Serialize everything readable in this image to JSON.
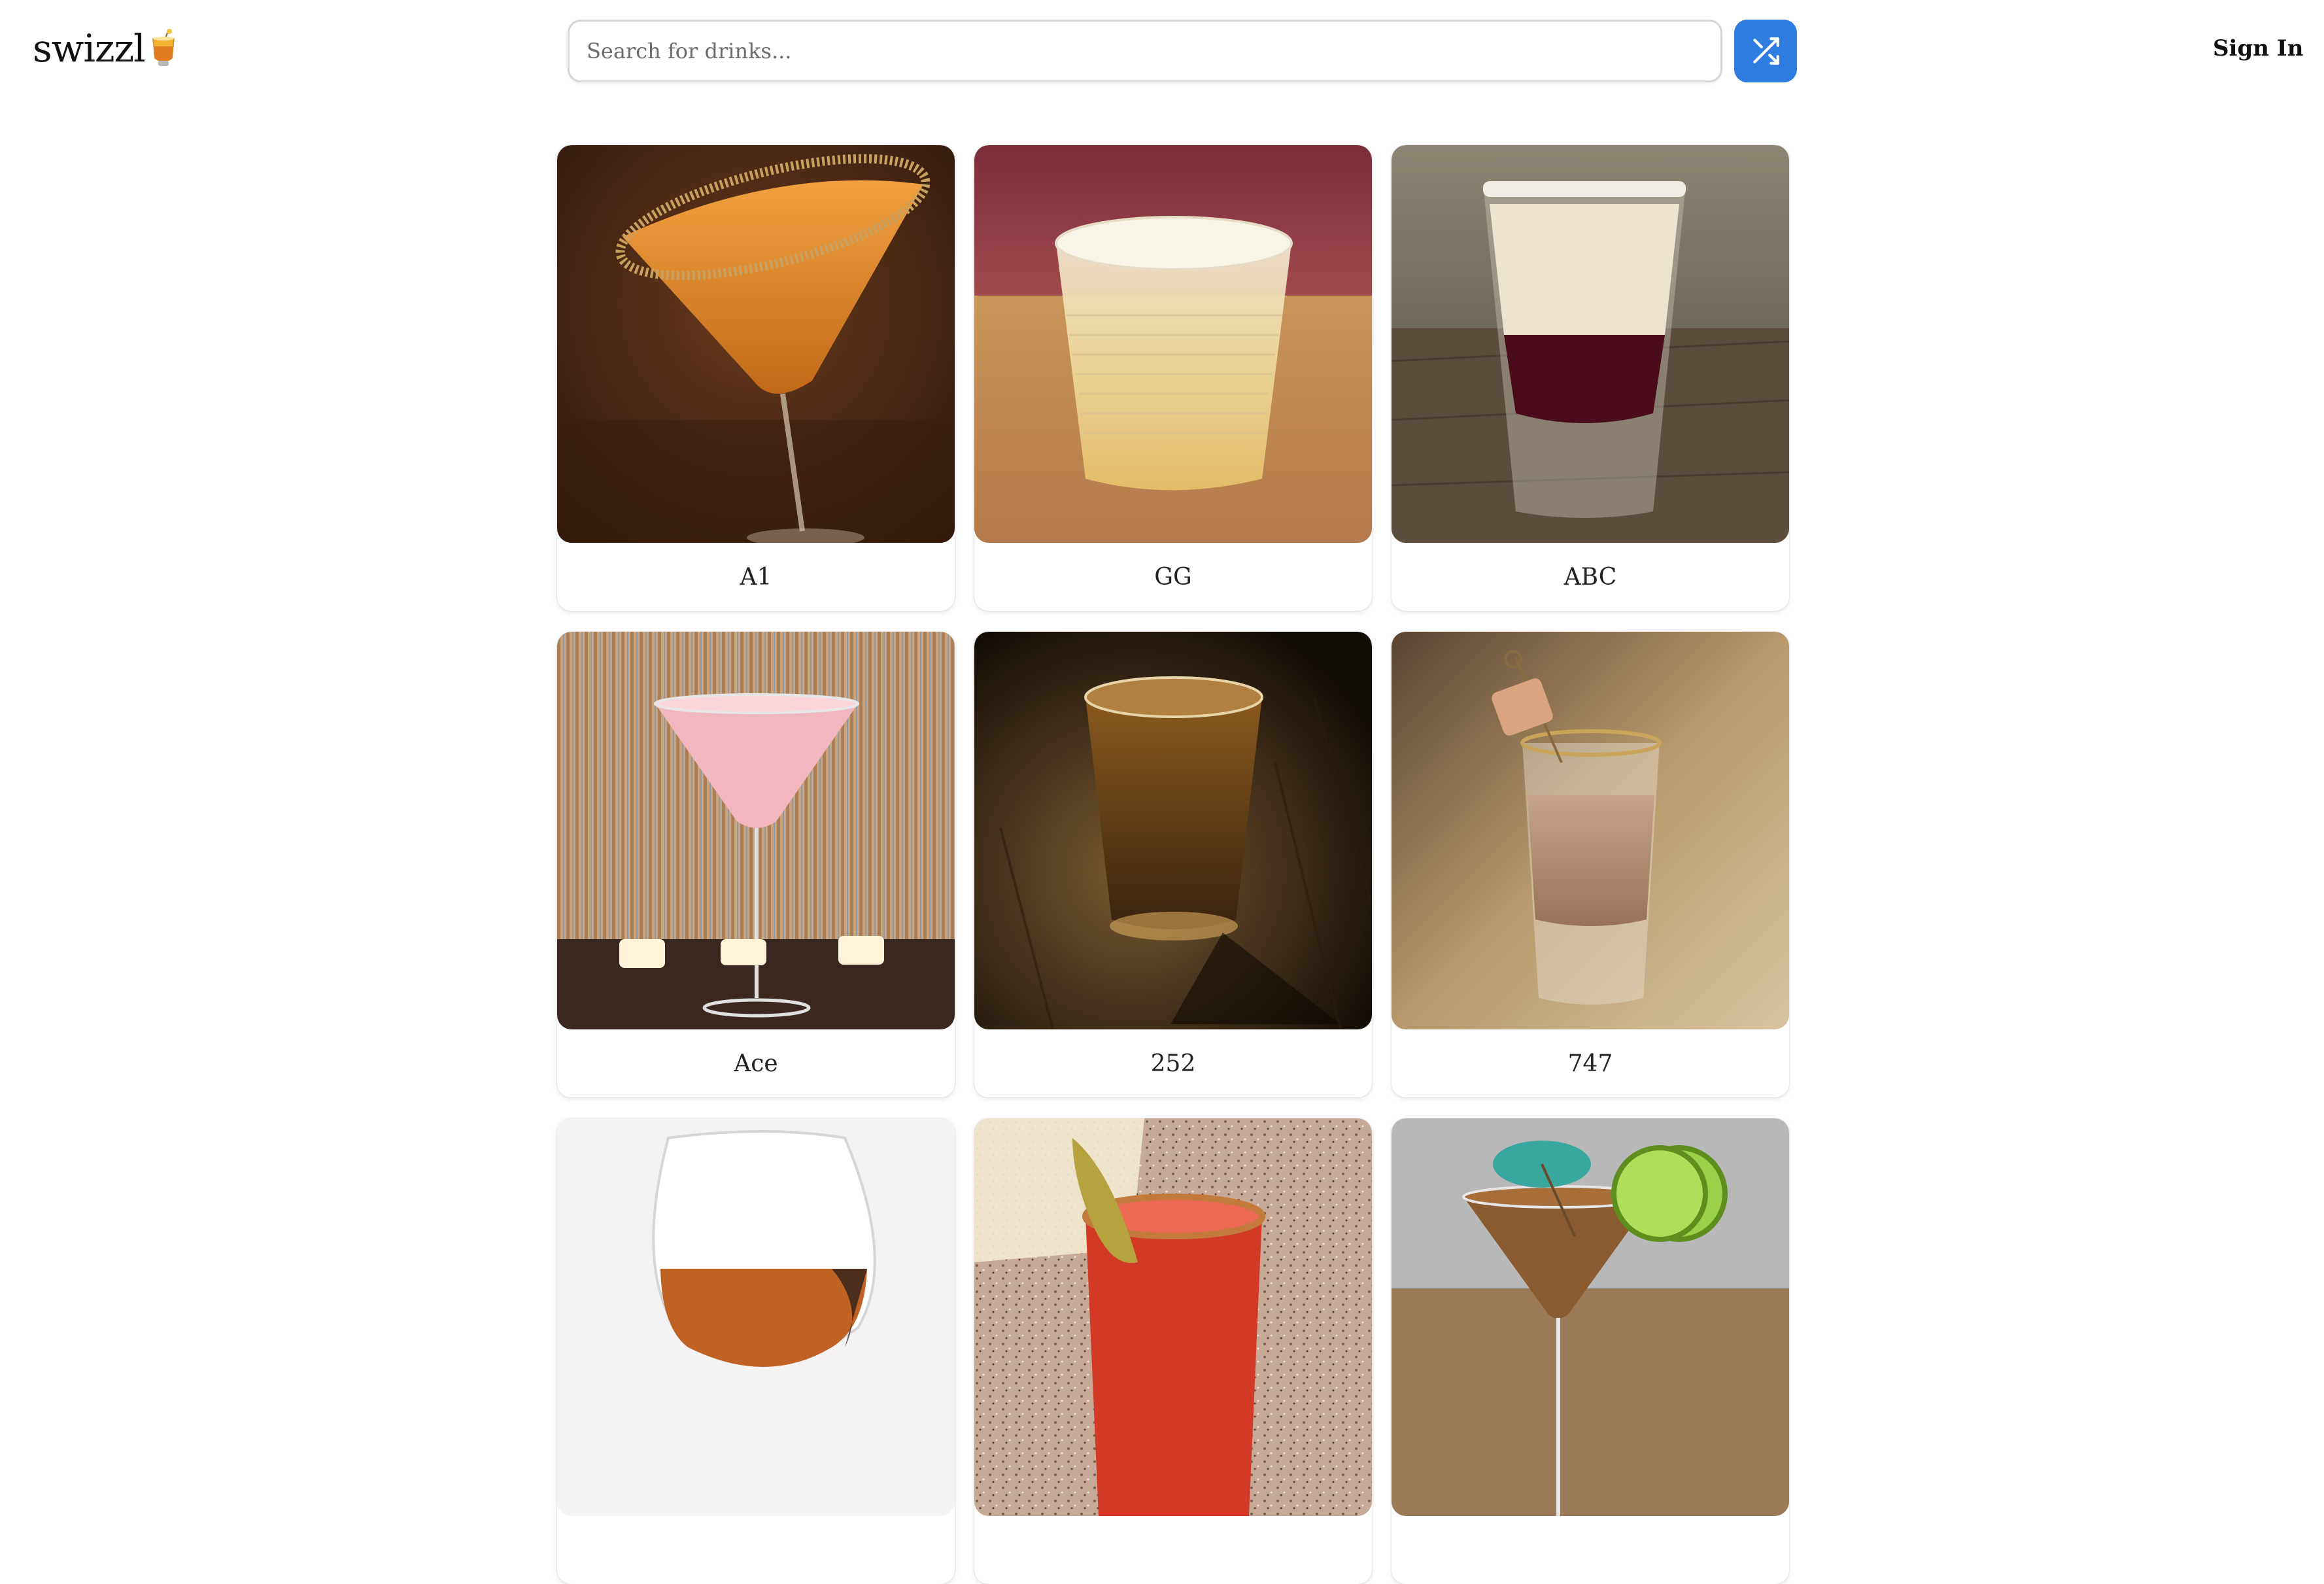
{
  "header": {
    "logo_text": "swizzl",
    "logo_icon": "cocktail-glass-icon",
    "search_placeholder": "Search for drinks...",
    "shuffle_icon": "shuffle-icon",
    "sign_in_label": "Sign In"
  },
  "colors": {
    "accent": "#2f7de1",
    "background": "#ffffff",
    "card_shadow": "#e2e2e2"
  },
  "drinks": [
    {
      "name": "A1"
    },
    {
      "name": "GG"
    },
    {
      "name": "ABC"
    },
    {
      "name": "Ace"
    },
    {
      "name": "252"
    },
    {
      "name": "747"
    },
    {
      "name": ""
    },
    {
      "name": ""
    },
    {
      "name": ""
    }
  ]
}
